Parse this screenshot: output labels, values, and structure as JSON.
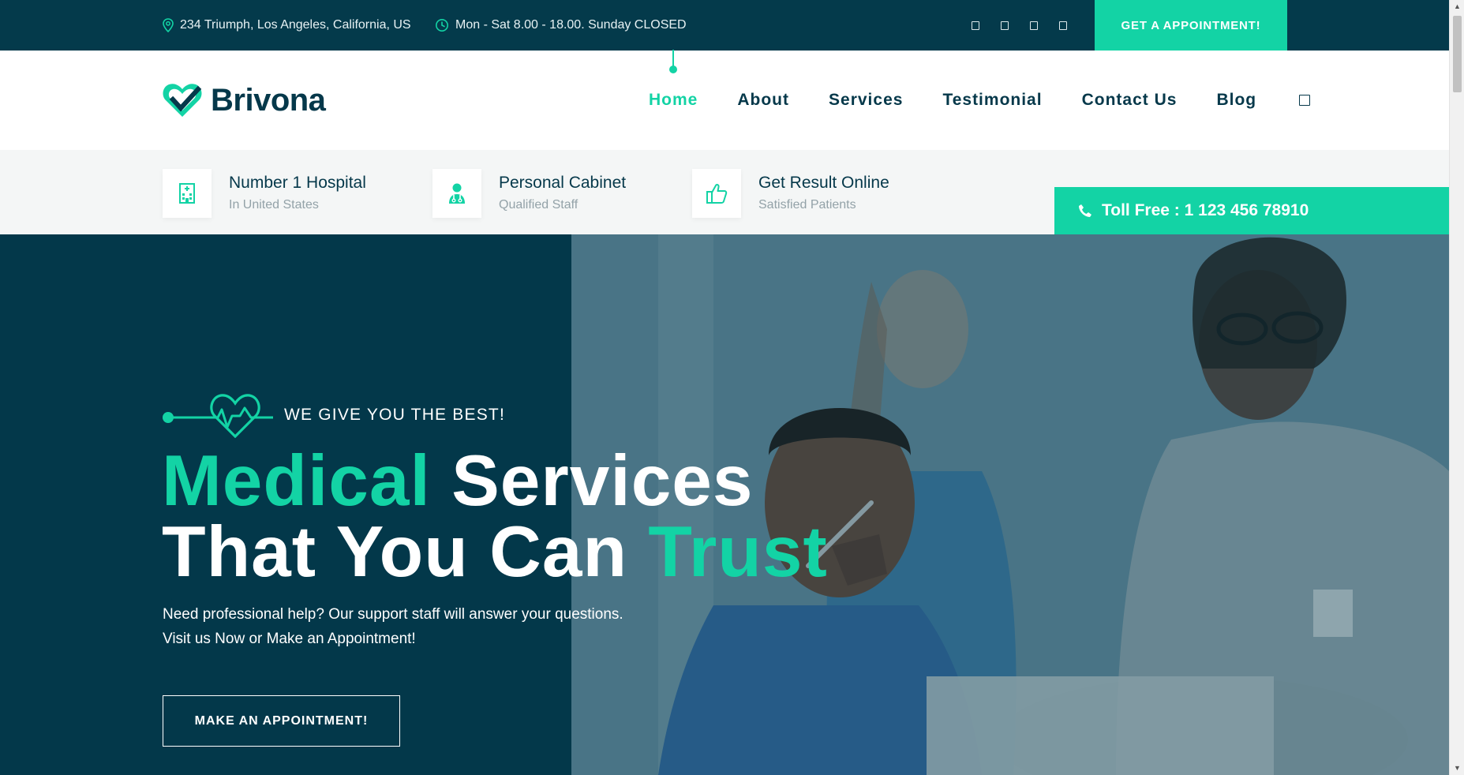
{
  "topbar": {
    "address": "234 Triumph, Los Angeles, California, US",
    "hours": "Mon - Sat 8.00 - 18.00. Sunday CLOSED",
    "social_icons": [
      "facebook-icon",
      "twitter-icon",
      "instagram-icon",
      "linkedin-icon"
    ],
    "appointment_label": "GET A APPOINTMENT!"
  },
  "brand": {
    "name": "Brivona"
  },
  "nav": {
    "items": [
      {
        "label": "Home",
        "active": true
      },
      {
        "label": "About"
      },
      {
        "label": "Services"
      },
      {
        "label": "Testimonial"
      },
      {
        "label": "Contact Us"
      },
      {
        "label": "Blog"
      }
    ],
    "search_icon": "search-icon"
  },
  "features": [
    {
      "title": "Number 1 Hospital",
      "subtitle": "In United States",
      "icon": "hospital-icon"
    },
    {
      "title": "Personal Cabinet",
      "subtitle": "Qualified Staff",
      "icon": "doctor-icon"
    },
    {
      "title": "Get Result Online",
      "subtitle": "Satisfied Patients",
      "icon": "thumbs-up-icon"
    }
  ],
  "tollfree": {
    "label": "Toll Free : 1 123 456 78910",
    "icon": "phone-icon"
  },
  "hero": {
    "tagline": "WE GIVE YOU THE BEST!",
    "headline_line1_accent": "Medical",
    "headline_line1_rest": " Services",
    "headline_line2_rest": "That You Can ",
    "headline_line2_accent": "Trust",
    "description_line1": "Need professional help? Our support staff will answer your questions.",
    "description_line2": "Visit us Now or Make an Appointment!",
    "button_label": "MAKE AN APPOINTMENT!"
  },
  "colors": {
    "primary_dark": "#043a4b",
    "accent": "#13d3a5",
    "muted_text": "#93a2a8",
    "strip_bg": "#f4f6f6"
  }
}
